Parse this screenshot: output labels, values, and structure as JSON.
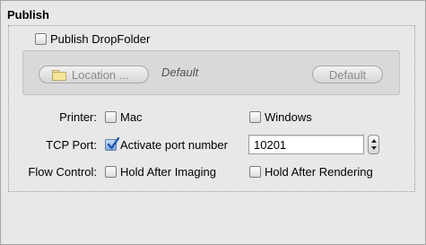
{
  "panel": {
    "title": "Publish"
  },
  "dropfolder": {
    "label": "Publish DropFolder",
    "checked": false
  },
  "location": {
    "button_label": "Location ...",
    "value": "Default",
    "default_button_label": "Default"
  },
  "printer": {
    "label": "Printer:",
    "options": [
      {
        "label": "Mac",
        "checked": false
      },
      {
        "label": "Windows",
        "checked": false
      }
    ]
  },
  "tcp": {
    "label": "TCP Port:",
    "activate_label": "Activate port number",
    "activate_checked": true,
    "port_value": "10201"
  },
  "flow": {
    "label": "Flow Control:",
    "options": [
      {
        "label": "Hold After Imaging",
        "checked": false
      },
      {
        "label": "Hold After Rendering",
        "checked": false
      }
    ]
  },
  "colors": {
    "background": "#e8e8e8",
    "check_accent": "#1e57b0"
  },
  "icons": {
    "folder": "folder-icon",
    "stepper": "stepper-icon",
    "check": "checkmark-icon"
  }
}
